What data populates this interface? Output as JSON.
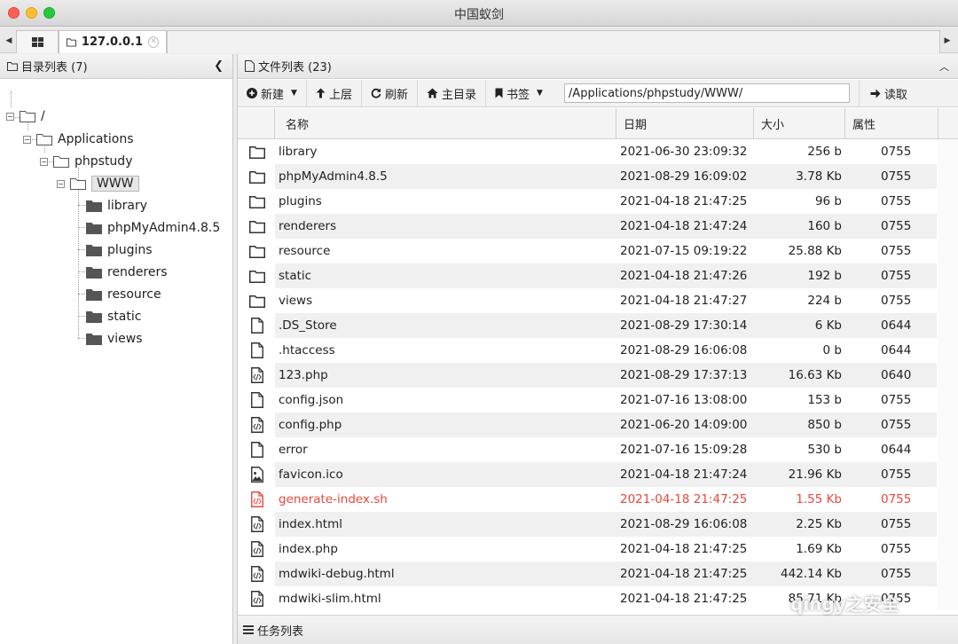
{
  "window": {
    "title": "中国蚁剑"
  },
  "tabs": {
    "host_label": "127.0.0.1"
  },
  "left": {
    "header": "目录列表 (7)",
    "tree": {
      "root": "/",
      "applications": "Applications",
      "phpstudy": "phpstudy",
      "www": "WWW",
      "children": [
        "library",
        "phpMyAdmin4.8.5",
        "plugins",
        "renderers",
        "resource",
        "static",
        "views"
      ]
    }
  },
  "right": {
    "header": "文件列表 (23)",
    "toolbar": {
      "new_label": "新建",
      "up_label": "上层",
      "refresh_label": "刷新",
      "home_label": "主目录",
      "bookmark_label": "书签",
      "path_value": "/Applications/phpstudy/WWW/",
      "read_label": "读取"
    },
    "columns": {
      "name": "名称",
      "date": "日期",
      "size": "大小",
      "attr": "属性"
    },
    "files": [
      {
        "icon": "folder",
        "name": "library",
        "date": "2021-06-30 23:09:32",
        "size": "256 b",
        "attr": "0755"
      },
      {
        "icon": "folder",
        "name": "phpMyAdmin4.8.5",
        "date": "2021-08-29 16:09:02",
        "size": "3.78 Kb",
        "attr": "0755"
      },
      {
        "icon": "folder",
        "name": "plugins",
        "date": "2021-04-18 21:47:25",
        "size": "96 b",
        "attr": "0755"
      },
      {
        "icon": "folder",
        "name": "renderers",
        "date": "2021-04-18 21:47:24",
        "size": "160 b",
        "attr": "0755"
      },
      {
        "icon": "folder",
        "name": "resource",
        "date": "2021-07-15 09:19:22",
        "size": "25.88 Kb",
        "attr": "0755"
      },
      {
        "icon": "folder",
        "name": "static",
        "date": "2021-04-18 21:47:26",
        "size": "192 b",
        "attr": "0755"
      },
      {
        "icon": "folder",
        "name": "views",
        "date": "2021-04-18 21:47:27",
        "size": "224 b",
        "attr": "0755"
      },
      {
        "icon": "file",
        "name": ".DS_Store",
        "date": "2021-08-29 17:30:14",
        "size": "6 Kb",
        "attr": "0644"
      },
      {
        "icon": "file",
        "name": ".htaccess",
        "date": "2021-08-29 16:06:08",
        "size": "0 b",
        "attr": "0644"
      },
      {
        "icon": "code",
        "name": "123.php",
        "date": "2021-08-29 17:37:13",
        "size": "16.63 Kb",
        "attr": "0640"
      },
      {
        "icon": "file",
        "name": "config.json",
        "date": "2021-07-16 13:08:00",
        "size": "153 b",
        "attr": "0755"
      },
      {
        "icon": "code",
        "name": "config.php",
        "date": "2021-06-20 14:09:00",
        "size": "850 b",
        "attr": "0755"
      },
      {
        "icon": "file",
        "name": "error",
        "date": "2021-07-16 15:09:28",
        "size": "530 b",
        "attr": "0644"
      },
      {
        "icon": "image",
        "name": "favicon.ico",
        "date": "2021-04-18 21:47:24",
        "size": "21.96 Kb",
        "attr": "0755"
      },
      {
        "icon": "code",
        "name": "generate-index.sh",
        "date": "2021-04-18 21:47:25",
        "size": "1.55 Kb",
        "attr": "0755",
        "highlight": "#e8473b"
      },
      {
        "icon": "code",
        "name": "index.html",
        "date": "2021-08-29 16:06:08",
        "size": "2.25 Kb",
        "attr": "0755"
      },
      {
        "icon": "code",
        "name": "index.php",
        "date": "2021-04-18 21:47:25",
        "size": "1.69 Kb",
        "attr": "0755"
      },
      {
        "icon": "code",
        "name": "mdwiki-debug.html",
        "date": "2021-04-18 21:47:25",
        "size": "442.14 Kb",
        "attr": "0755"
      },
      {
        "icon": "code",
        "name": "mdwiki-slim.html",
        "date": "2021-04-18 21:47:25",
        "size": "85.71 Kb",
        "attr": "0755"
      }
    ]
  },
  "taskbar": {
    "label": "任务列表"
  },
  "watermark": {
    "text": "qingy之安全"
  }
}
